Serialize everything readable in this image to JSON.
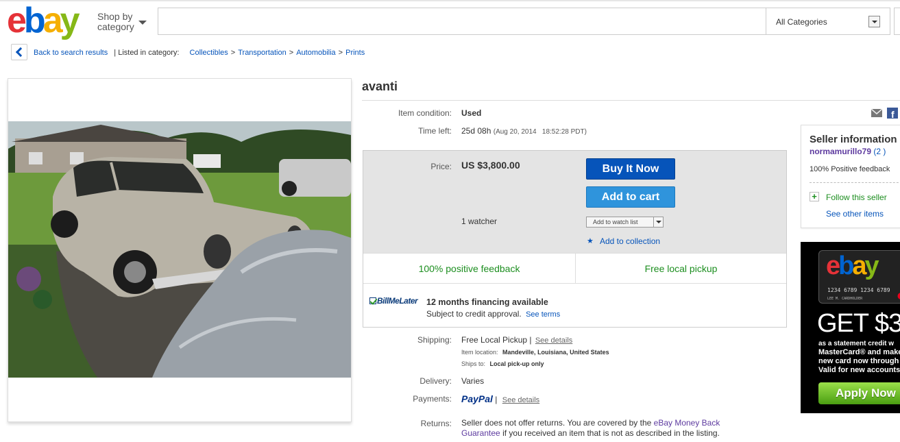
{
  "header": {
    "logo_text": "ebay",
    "shop_by_line1": "Shop by",
    "shop_by_line2": "category",
    "search_value": "",
    "category_select": "All Categories"
  },
  "breadcrumb": {
    "back_label": "Back to search results",
    "listed_in": "| Listed in category:",
    "categories": [
      "Collectibles",
      "Transportation",
      "Automobilia",
      "Prints"
    ]
  },
  "item": {
    "title": "avanti",
    "condition_label": "Item condition:",
    "condition_value": "Used",
    "time_left_label": "Time left:",
    "time_left_value": "25d 08h",
    "end_time": "(Aug 20, 2014   18:52:28 PDT)",
    "price_label": "Price:",
    "price_value": "US $3,800.00",
    "watchers": "1 watcher",
    "buy_it_now_label": "Buy It Now",
    "add_to_cart_label": "Add to cart",
    "add_to_watch_list_label": "Add to watch list",
    "add_to_collection_label": "Add to collection",
    "feature_1": "100% positive feedback",
    "feature_2": "Free local pickup",
    "bml_logo": "BillMeLater",
    "financing_title": "12 months financing available",
    "financing_sub": "Subject to credit approval.",
    "see_terms": "See terms",
    "shipping_label": "Shipping:",
    "shipping_value": "Free Local Pickup |",
    "shipping_details_link": "See details",
    "item_location_label": "Item location:",
    "item_location_value": "Mandeville, Louisiana, United States",
    "ships_to_label": "Ships to:",
    "ships_to_value": "Local pick-up only",
    "delivery_label": "Delivery:",
    "delivery_value": "Varies",
    "payments_label": "Payments:",
    "payments_brand": "PayPal",
    "payments_sep": "|",
    "payments_details_link": "See details",
    "returns_label": "Returns:",
    "returns_text_1": "Seller does not offer returns. You are covered by the",
    "returns_link": "eBay Money Back Guarantee",
    "returns_text_2": "if you received an item that is not as described in the listing."
  },
  "seller": {
    "heading": "Seller information",
    "name": "normamurillo79",
    "score": "(2 )",
    "feedback": "100% Positive feedback",
    "follow_label": "Follow this seller",
    "other_items_label": "See other items"
  },
  "ad": {
    "logo_text": "ebay",
    "card_number": "1234 6789 1234 6789",
    "card_holder": "LEE M. CARDHOLDER",
    "headline": "GET $3",
    "line_1": "as a statement credit  w",
    "line_2": "MasterCard® and make",
    "line_3": "new card now through",
    "line_4": "Valid for new accounts",
    "button_label": "Apply Now"
  },
  "icons": {
    "share_email": "email-icon",
    "share_facebook": "facebook-icon",
    "collection": "star-icon"
  },
  "colors": {
    "link_blue": "#0654ba",
    "buy_button": "#0654ba",
    "cart_button": "#2f94dc",
    "positive_green": "#1c8e1f",
    "seller_purple": "#5d3a9f",
    "paypal_dark": "#003087",
    "paypal_light": "#009cde"
  }
}
